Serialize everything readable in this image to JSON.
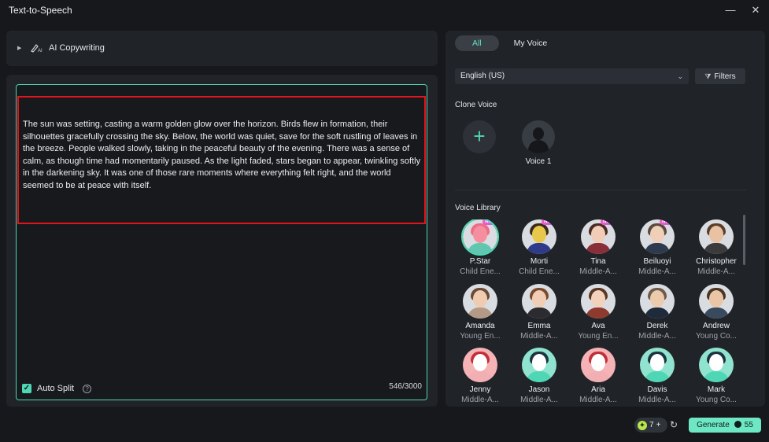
{
  "window": {
    "title": "Text-to-Speech",
    "minimize": "—",
    "close": "✕"
  },
  "copywriting": {
    "label": "AI Copywriting"
  },
  "editor": {
    "text": "The sun was setting, casting a warm golden glow over the horizon. Birds flew in formation, their silhouettes gracefully crossing the sky. Below, the world was quiet, save for the soft rustling of leaves in the breeze. People walked slowly, taking in the peaceful beauty of the evening. There was a sense of calm, as though time had momentarily paused. As the light faded, stars began to appear, twinkling softly in the darkening sky. It was one of those rare moments where everything felt right, and the world seemed to be at peace with itself.",
    "auto_split_label": "Auto Split",
    "auto_split_checked": true,
    "char_count": "546/3000"
  },
  "tabs": [
    {
      "label": "All",
      "active": true
    },
    {
      "label": "My Voice",
      "active": false
    }
  ],
  "language": {
    "value": "English (US)"
  },
  "filters_label": "Filters",
  "clone": {
    "title": "Clone Voice",
    "add_icon": "plus-icon",
    "voices": [
      {
        "name": "Voice 1"
      }
    ]
  },
  "library": {
    "title": "Voice Library",
    "voices": [
      {
        "name": "P.Star",
        "desc": "Child Ene...",
        "new": true,
        "selected": true,
        "skin": "#f58fa0",
        "hair": "#ec6c86",
        "body": "#5fc7b0"
      },
      {
        "name": "Morti",
        "desc": "Child Ene...",
        "new": true,
        "selected": false,
        "skin": "#e8c84a",
        "hair": "#3a2a1a",
        "body": "#2f3a8a"
      },
      {
        "name": "Tina",
        "desc": "Middle-A...",
        "new": true,
        "selected": false,
        "skin": "#f1cdb8",
        "hair": "#4a2a22",
        "body": "#8a2e3a"
      },
      {
        "name": "Beiluoyi",
        "desc": "Middle-A...",
        "new": true,
        "selected": false,
        "skin": "#efcfb8",
        "hair": "#5a4a3e",
        "body": "#2e3a4e"
      },
      {
        "name": "Christopher",
        "desc": "Middle-A...",
        "new": false,
        "selected": false,
        "skin": "#e9c2a4",
        "hair": "#5b3e2a",
        "body": "#3b3b3b"
      },
      {
        "name": "Amanda",
        "desc": "Young En...",
        "new": false,
        "selected": false,
        "skin": "#efcbb0",
        "hair": "#6a4a34",
        "body": "#b49a86"
      },
      {
        "name": "Emma",
        "desc": "Middle-A...",
        "new": false,
        "selected": false,
        "skin": "#f0cdb4",
        "hair": "#7a4a2a",
        "body": "#2b2b30"
      },
      {
        "name": "Ava",
        "desc": "Young En...",
        "new": false,
        "selected": false,
        "skin": "#f2d2bd",
        "hair": "#5a3626",
        "body": "#8e3a2e"
      },
      {
        "name": "Derek",
        "desc": "Middle-A...",
        "new": false,
        "selected": false,
        "skin": "#eccaae",
        "hair": "#6e5a48",
        "body": "#1f2a3a"
      },
      {
        "name": "Andrew",
        "desc": "Young Co...",
        "new": false,
        "selected": false,
        "skin": "#eac6a6",
        "hair": "#4a3424",
        "body": "#3a4a5e"
      },
      {
        "name": "Jenny",
        "desc": "Middle-A...",
        "new": false,
        "selected": false,
        "skin": "#ffffff",
        "hair": "#c1303a",
        "body": "#f1aeb3",
        "bg": "#f5b3b6"
      },
      {
        "name": "Jason",
        "desc": "Middle-A...",
        "new": false,
        "selected": false,
        "skin": "#ffffff",
        "hair": "#1d3440",
        "body": "#4fd6b4",
        "bg": "#8fe3cf"
      },
      {
        "name": "Aria",
        "desc": "Middle-A...",
        "new": false,
        "selected": false,
        "skin": "#ffffff",
        "hair": "#c1303a",
        "body": "#f1aeb3",
        "bg": "#f5b3b6"
      },
      {
        "name": "Davis",
        "desc": "Middle-A...",
        "new": false,
        "selected": false,
        "skin": "#ffffff",
        "hair": "#1d3440",
        "body": "#4fd6b4",
        "bg": "#8fe3cf"
      },
      {
        "name": "Mark",
        "desc": "Young Co...",
        "new": false,
        "selected": false,
        "skin": "#ffffff",
        "hair": "#1d3440",
        "body": "#4fd6b4",
        "bg": "#8fe3cf"
      }
    ]
  },
  "footer": {
    "credits": "7",
    "credits_plus": "+",
    "generate_label": "Generate",
    "generate_cost": "55"
  },
  "colors": {
    "accent": "#4fd6b4",
    "selection": "#e3141b",
    "generate_bg": "#6ee7c5"
  }
}
